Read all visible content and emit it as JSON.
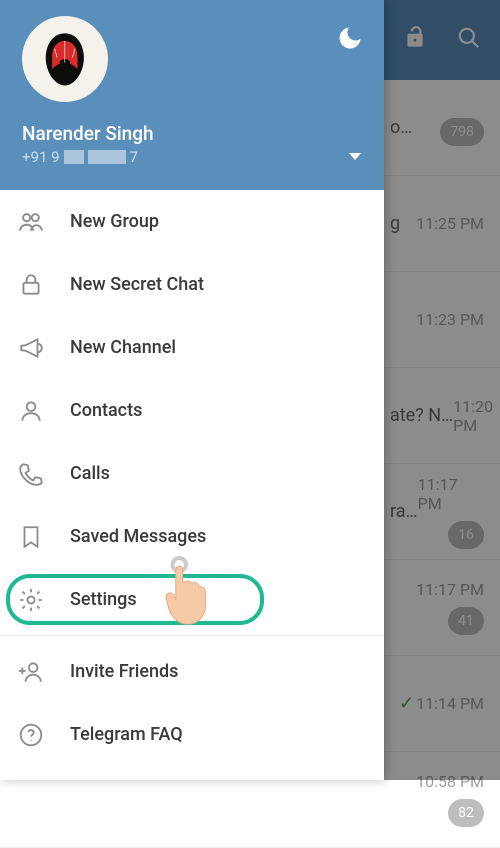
{
  "header": {
    "user_name": "Narender Singh",
    "phone_prefix": "+91 9",
    "phone_suffix": "7"
  },
  "menu": {
    "new_group": "New Group",
    "new_secret_chat": "New Secret Chat",
    "new_channel": "New Channel",
    "contacts": "Contacts",
    "calls": "Calls",
    "saved_messages": "Saved Messages",
    "settings": "Settings",
    "invite_friends": "Invite Friends",
    "telegram_faq": "Telegram FAQ"
  },
  "chats": [
    {
      "snippet": "o…",
      "time": "",
      "badge": "798"
    },
    {
      "snippet": "g",
      "time": "11:25 PM",
      "badge": ""
    },
    {
      "snippet": "",
      "time": "11:23 PM",
      "badge": ""
    },
    {
      "snippet": "ate? N…",
      "time": "11:20 PM",
      "badge": ""
    },
    {
      "snippet": "ra…",
      "time": "11:17 PM",
      "badge": "16"
    },
    {
      "snippet": "",
      "time": "11:17 PM",
      "badge": "41"
    },
    {
      "snippet": "",
      "time": "11:14 PM",
      "badge": "",
      "tick": true
    },
    {
      "snippet": "",
      "time": "10:58 PM",
      "badge": "82"
    }
  ]
}
